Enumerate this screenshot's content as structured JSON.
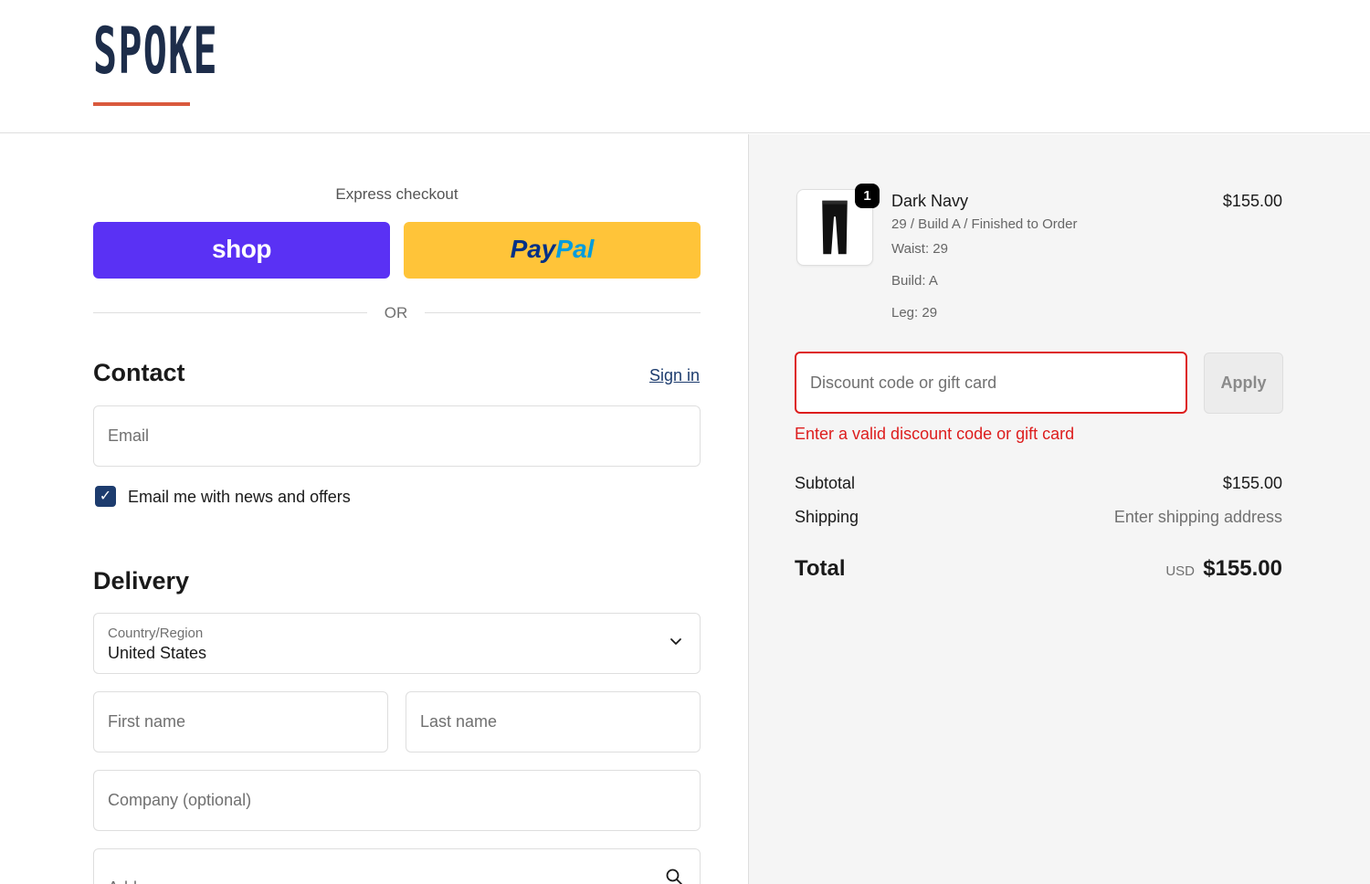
{
  "brand": {
    "logo_text": "SPOKE",
    "accent": "#d9593d",
    "navy": "#1d2d4a"
  },
  "express": {
    "title": "Express checkout",
    "shop_label": "shop",
    "paypal_part1": "Pay",
    "paypal_part2": "Pal",
    "or_label": "OR"
  },
  "contact": {
    "title": "Contact",
    "sign_in": "Sign in",
    "email_placeholder": "Email",
    "newsletter_label": "Email me with news and offers",
    "newsletter_checked": true
  },
  "delivery": {
    "title": "Delivery",
    "country_label": "Country/Region",
    "country_value": "United States",
    "first_name_placeholder": "First name",
    "last_name_placeholder": "Last name",
    "company_placeholder": "Company (optional)",
    "address_placeholder": "Address"
  },
  "order": {
    "item": {
      "quantity": "1",
      "name": "Dark Navy",
      "variant": "29 / Build A / Finished to Order",
      "waist": "Waist: 29",
      "build": "Build: A",
      "leg": "Leg: 29",
      "price": "$155.00",
      "icon": "pants-icon"
    },
    "discount_placeholder": "Discount code or gift card",
    "apply_label": "Apply",
    "discount_error": "Enter a valid discount code or gift card",
    "subtotal_label": "Subtotal",
    "subtotal_value": "$155.00",
    "shipping_label": "Shipping",
    "shipping_value": "Enter shipping address",
    "total_label": "Total",
    "total_currency": "USD",
    "total_value": "$155.00"
  }
}
